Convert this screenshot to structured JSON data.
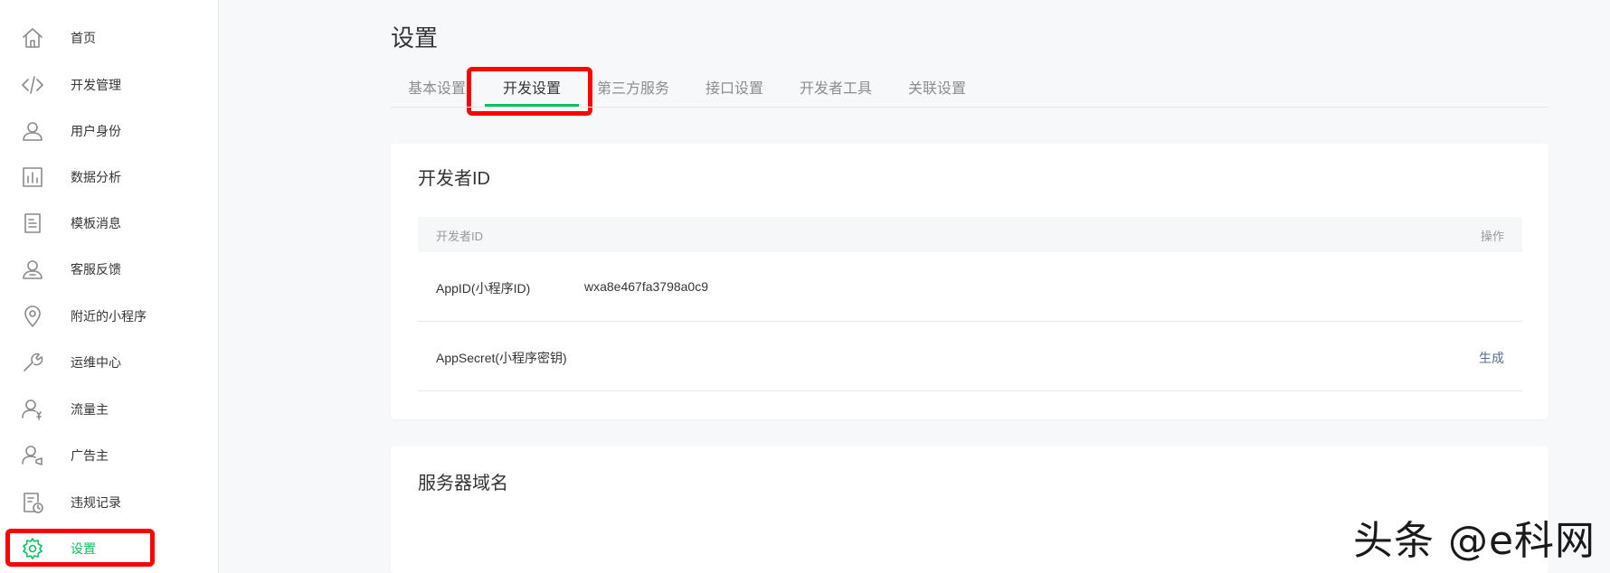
{
  "sidebar": {
    "items": [
      {
        "label": "首页",
        "icon": "home-icon"
      },
      {
        "label": "开发管理",
        "icon": "code-icon"
      },
      {
        "label": "用户身份",
        "icon": "user-icon"
      },
      {
        "label": "数据分析",
        "icon": "bar-chart-icon"
      },
      {
        "label": "模板消息",
        "icon": "document-icon"
      },
      {
        "label": "客服反馈",
        "icon": "customer-service-icon"
      },
      {
        "label": "附近的小程序",
        "icon": "location-pin-icon"
      },
      {
        "label": "运维中心",
        "icon": "wrench-icon"
      },
      {
        "label": "流量主",
        "icon": "user-yen-icon"
      },
      {
        "label": "广告主",
        "icon": "user-ad-icon"
      },
      {
        "label": "违规记录",
        "icon": "record-clock-icon"
      },
      {
        "label": "设置",
        "icon": "gear-icon",
        "active": true
      }
    ]
  },
  "page": {
    "title": "设置"
  },
  "tabs": [
    {
      "label": "基本设置"
    },
    {
      "label": "开发设置",
      "active": true
    },
    {
      "label": "第三方服务"
    },
    {
      "label": "接口设置"
    },
    {
      "label": "开发者工具"
    },
    {
      "label": "关联设置"
    }
  ],
  "developer_card": {
    "title": "开发者ID",
    "table": {
      "headers": {
        "name": "开发者ID",
        "action": "操作"
      },
      "rows": [
        {
          "name": "AppID(小程序ID)",
          "value": "wxa8e467fa3798a0c9",
          "action": ""
        },
        {
          "name": "AppSecret(小程序密钥)",
          "value": "",
          "action": "生成"
        }
      ]
    }
  },
  "server_card": {
    "title": "服务器域名"
  },
  "watermark": "头条 @e科网",
  "colors": {
    "accent": "#07c160",
    "link": "#576b95",
    "highlight": "#ff0000",
    "background": "#f7f8fa"
  }
}
